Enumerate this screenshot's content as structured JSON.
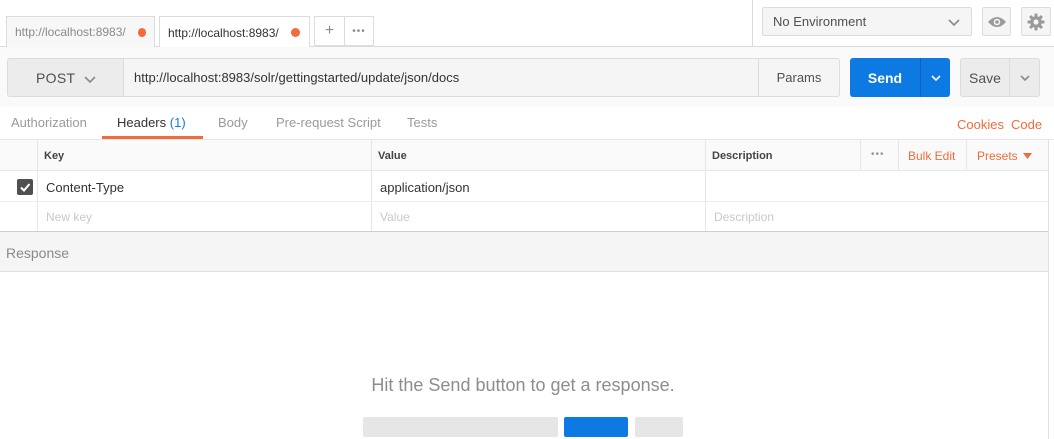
{
  "tabs": [
    {
      "title": "http://localhost:8983/"
    },
    {
      "title": "http://localhost:8983/"
    }
  ],
  "tab_controls": {
    "new_tab": "+",
    "more": "•••"
  },
  "environment": {
    "selected": "No Environment"
  },
  "request": {
    "method": "POST",
    "url": "http://localhost:8983/solr/gettingstarted/update/json/docs",
    "params_label": "Params",
    "send_label": "Send",
    "save_label": "Save"
  },
  "subtabs": {
    "authorization": "Authorization",
    "headers": "Headers",
    "headers_count": "(1)",
    "body": "Body",
    "prerequest": "Pre-request Script",
    "tests": "Tests",
    "cookies": "Cookies",
    "code": "Code"
  },
  "headers_table": {
    "columns": {
      "key": "Key",
      "value": "Value",
      "description": "Description"
    },
    "more": "•••",
    "bulk_edit": "Bulk Edit",
    "presets": "Presets",
    "rows": [
      {
        "checked": true,
        "key": "Content-Type",
        "value": "application/json",
        "description": ""
      }
    ],
    "placeholders": {
      "key": "New key",
      "value": "Value",
      "description": "Description"
    }
  },
  "response": {
    "title": "Response",
    "hint": "Hit the Send button to get a response."
  },
  "colors": {
    "accent": "#f26b3a",
    "primary": "#0d7ae4"
  }
}
